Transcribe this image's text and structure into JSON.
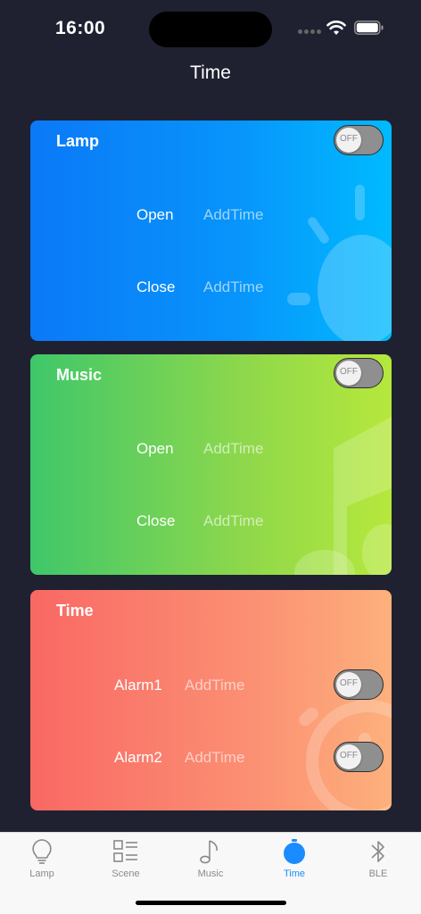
{
  "status_bar": {
    "time": "16:00"
  },
  "header": {
    "title": "Time"
  },
  "cards": {
    "lamp": {
      "title": "Lamp",
      "toggle_label": "OFF",
      "rows": [
        {
          "label": "Open",
          "value": "AddTime"
        },
        {
          "label": "Close",
          "value": "AddTime"
        }
      ]
    },
    "music": {
      "title": "Music",
      "toggle_label": "OFF",
      "rows": [
        {
          "label": "Open",
          "value": "AddTime"
        },
        {
          "label": "Close",
          "value": "AddTime"
        }
      ]
    },
    "time": {
      "title": "Time",
      "rows": [
        {
          "label": "Alarm1",
          "value": "AddTime",
          "toggle_label": "OFF"
        },
        {
          "label": "Alarm2",
          "value": "AddTime",
          "toggle_label": "OFF"
        }
      ]
    }
  },
  "tabbar": {
    "active": "Time",
    "accent_color": "#1a8cff",
    "items": [
      {
        "label": "Lamp",
        "icon": "bulb-icon"
      },
      {
        "label": "Scene",
        "icon": "list-grid-icon"
      },
      {
        "label": "Music",
        "icon": "music-note-icon"
      },
      {
        "label": "Time",
        "icon": "stopwatch-icon"
      },
      {
        "label": "BLE",
        "icon": "bluetooth-icon"
      }
    ]
  }
}
